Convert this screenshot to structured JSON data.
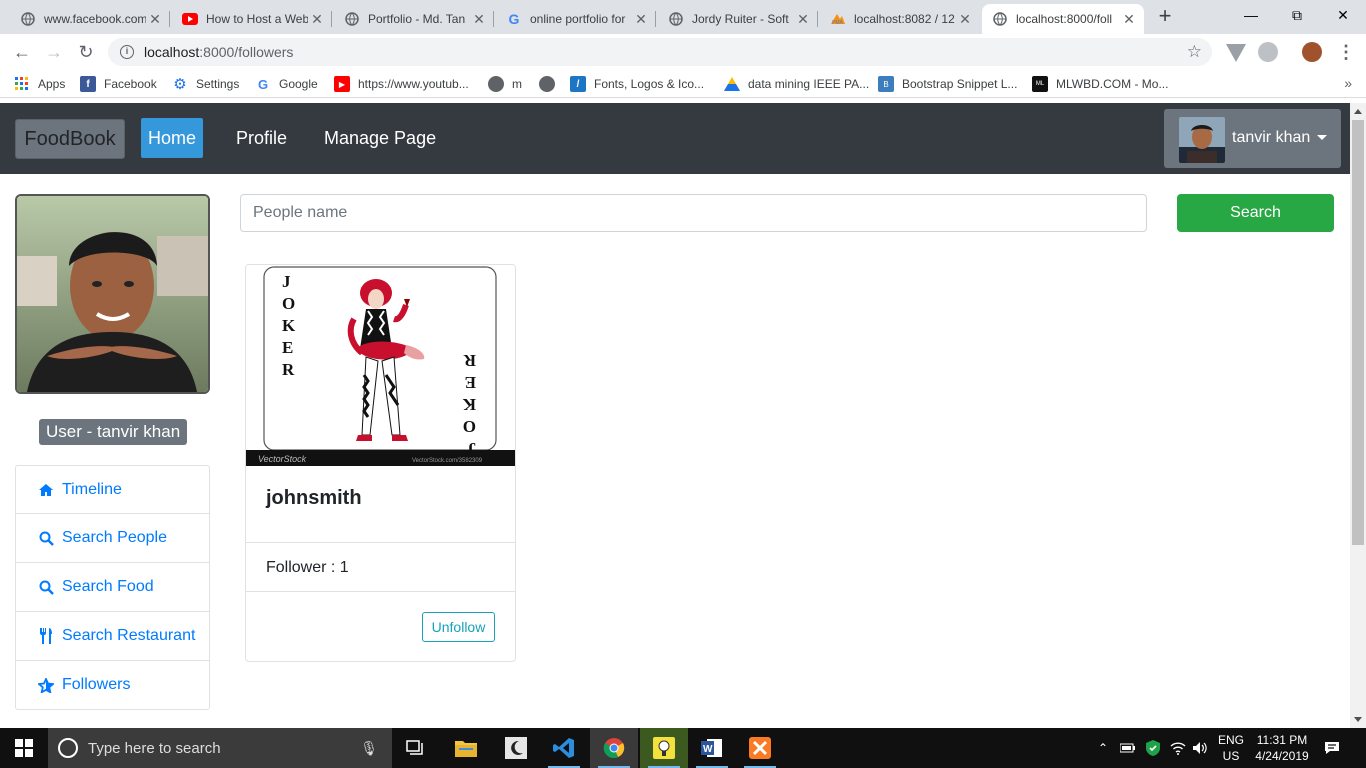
{
  "browser": {
    "tabs": [
      {
        "title": "www.facebook.com",
        "icon": "globe-icon"
      },
      {
        "title": "How to Host a Web",
        "icon": "youtube-icon"
      },
      {
        "title": "Portfolio - Md. Tan",
        "icon": "globe-icon"
      },
      {
        "title": "online portfolio for",
        "icon": "google-icon"
      },
      {
        "title": "Jordy Ruiter - Soft",
        "icon": "globe-icon"
      },
      {
        "title": "localhost:8082 / 12",
        "icon": "phpmyadmin-icon"
      },
      {
        "title": "localhost:8000/foll",
        "icon": "globe-icon",
        "active": true
      }
    ],
    "url_host": "localhost",
    "url_path": ":8000/followers",
    "bookmarks": [
      {
        "label": "Apps",
        "icon": "apps-grid-icon"
      },
      {
        "label": "Facebook",
        "icon": "facebook-icon"
      },
      {
        "label": "Settings",
        "icon": "gear-icon"
      },
      {
        "label": "Google",
        "icon": "google-icon"
      },
      {
        "label": "https://www.youtub...",
        "icon": "youtube-icon"
      },
      {
        "label": "m",
        "icon": "globe-icon"
      },
      {
        "label": "",
        "icon": "globe-icon"
      },
      {
        "label": "Fonts, Logos & Ico...",
        "icon": "fonts-icon"
      },
      {
        "label": "data mining IEEE PA...",
        "icon": "drive-icon"
      },
      {
        "label": "Bootstrap Snippet L...",
        "icon": "bootstrap-icon"
      },
      {
        "label": "MLWBD.COM - Mo...",
        "icon": "mlwbd-icon"
      }
    ]
  },
  "app": {
    "brand": "FoodBook",
    "nav": {
      "home": "Home",
      "profile": "Profile",
      "manage": "Manage Page"
    },
    "user_name": "tanvir khan",
    "user_badge": "User - tanvir khan",
    "sidebar": [
      {
        "label": "Timeline",
        "icon": "home-icon"
      },
      {
        "label": "Search People",
        "icon": "search-icon"
      },
      {
        "label": "Search Food",
        "icon": "search-icon"
      },
      {
        "label": "Search Restaurant",
        "icon": "utensils-icon"
      },
      {
        "label": "Followers",
        "icon": "star-icon"
      }
    ],
    "search": {
      "placeholder": "People name",
      "button": "Search"
    },
    "card": {
      "name": "johnsmith",
      "followers_text": "Follower : 1",
      "unfollow": "Unfollow",
      "image_caption_left": "VectorStock",
      "image_caption_right": "VectorStock.com/3582309"
    },
    "colors": {
      "navbar": "#343a40",
      "home_active": "#3498db",
      "link": "#007bff",
      "search_btn": "#28a745",
      "unfollow": "#17a2b8"
    }
  },
  "taskbar": {
    "search_placeholder": "Type here to search",
    "lang_top": "ENG",
    "lang_bottom": "US",
    "time": "11:31 PM",
    "date": "4/24/2019"
  }
}
